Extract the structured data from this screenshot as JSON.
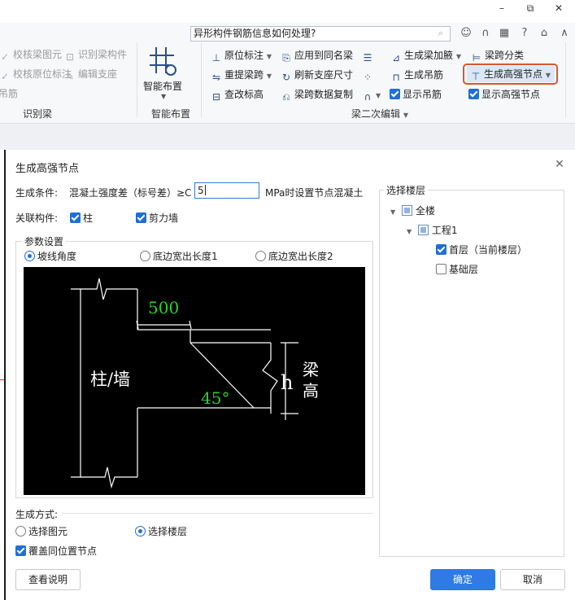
{
  "window": {
    "search_text": "异形构件钢筋信息如何处理?",
    "min": "–",
    "restore": "⧉",
    "close": "✕"
  },
  "ribbon": {
    "left_group": {
      "items": [
        "校核梁图元",
        "校核原位标注",
        "吊筋",
        "识别梁构件",
        "编辑支座"
      ],
      "label": "识别梁"
    },
    "smart": {
      "button": "智能布置",
      "label": "智能布置"
    },
    "edit_group": {
      "col1": [
        "原位标注",
        "重提梁跨",
        "查改标高"
      ],
      "col2": [
        "应用到同名梁",
        "刷新支座尺寸",
        "梁跨数据复制"
      ],
      "col4": [
        "生成梁加腋",
        "生成吊筋",
        "显示吊筋"
      ],
      "col5": [
        "梁跨分类",
        "生成高强节点",
        "显示高强节点"
      ],
      "label": "梁二次编辑"
    },
    "highlight_color": "#d9582b",
    "accent": "#1f6fd6"
  },
  "dialog": {
    "title": "生成高强节点",
    "condition_label": "生成条件:",
    "condition_text": "混凝土强度差（标号差）≥C",
    "condition_value": "5",
    "condition_suffix": "MPa时设置节点混凝土",
    "related_label": "关联构件:",
    "related": [
      {
        "label": "柱",
        "checked": true
      },
      {
        "label": "剪力墙",
        "checked": true
      }
    ],
    "params_legend": "参数设置",
    "param_options": [
      {
        "label": "坡线角度",
        "selected": true
      },
      {
        "label": "底边宽出长度1",
        "selected": false
      },
      {
        "label": "底边宽出长度2",
        "selected": false
      }
    ],
    "diagram": {
      "dim": "500",
      "wall": "柱/墙",
      "angle": "45°",
      "h": "h",
      "beam1": "梁",
      "beam2": "高"
    },
    "gen_mode_label": "生成方式:",
    "gen_modes": [
      {
        "label": "选择图元",
        "selected": false
      },
      {
        "label": "选择楼层",
        "selected": true
      }
    ],
    "overwrite": {
      "label": "覆盖同位置节点",
      "checked": true
    },
    "floor_legend": "选择楼层",
    "tree": [
      {
        "label": "全楼",
        "level": 0,
        "state": "partial"
      },
      {
        "label": "工程1",
        "level": 1,
        "state": "partial"
      },
      {
        "label": "首层（当前楼层）",
        "level": 2,
        "state": "checked"
      },
      {
        "label": "基础层",
        "level": 2,
        "state": "unchecked"
      }
    ],
    "buttons": {
      "help": "查看说明",
      "ok": "确定",
      "cancel": "取消"
    }
  }
}
